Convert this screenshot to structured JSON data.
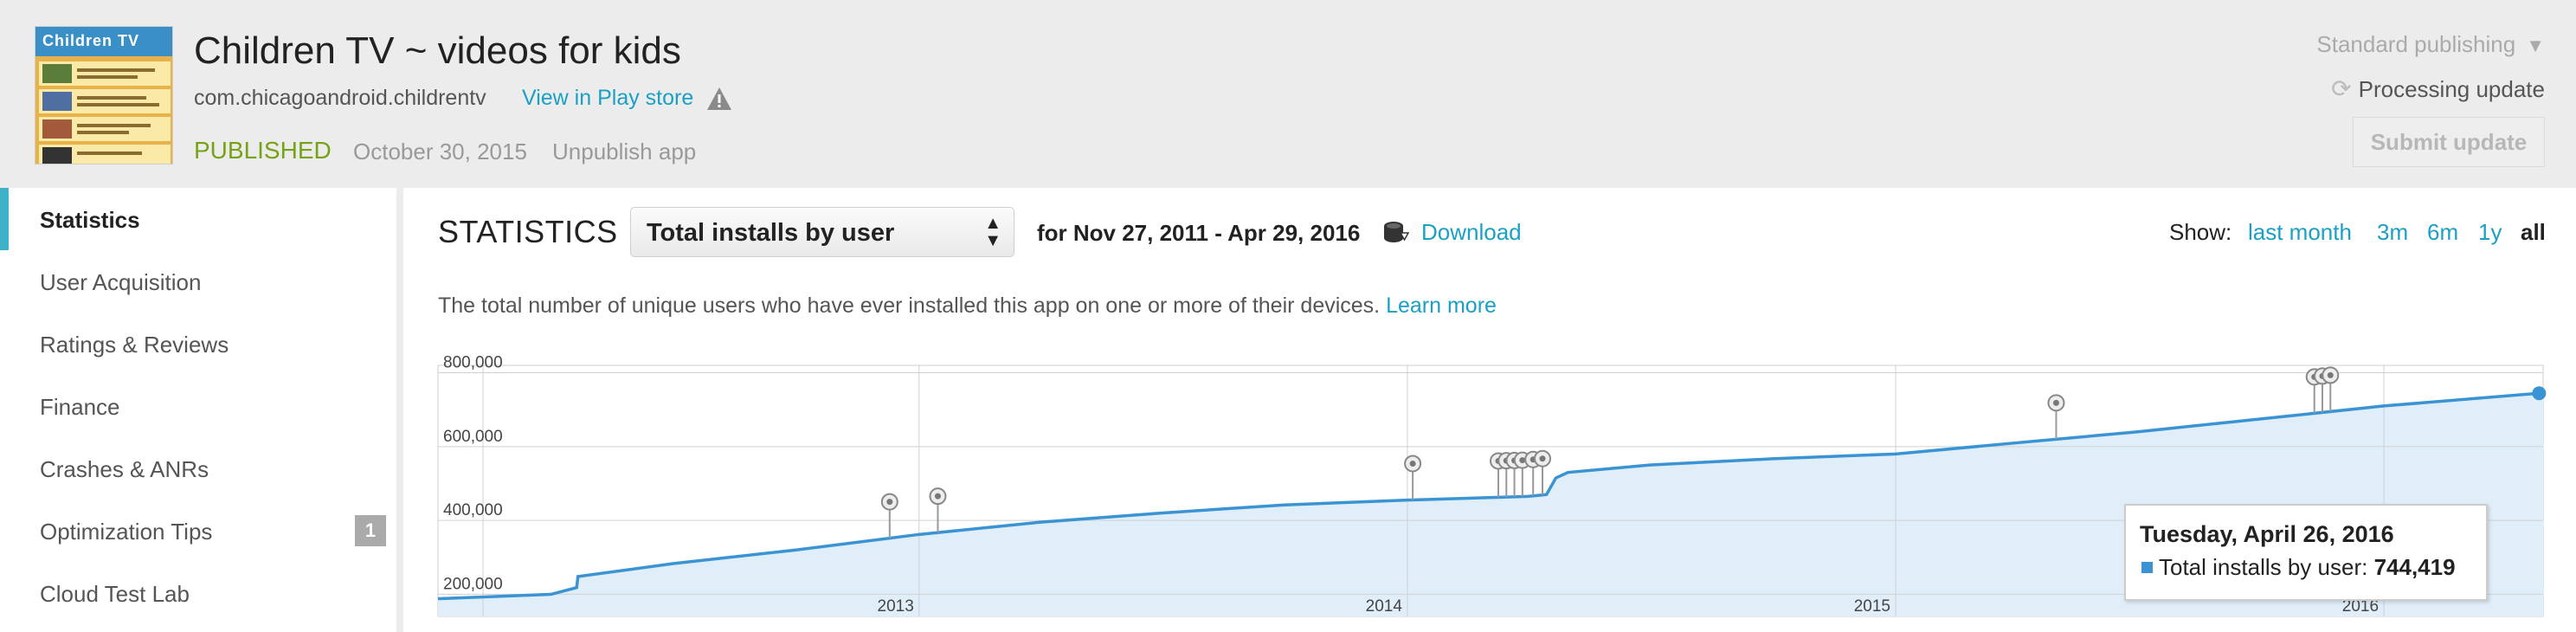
{
  "header": {
    "app_title": "Children TV ~ videos for kids",
    "package_name": "com.chicagoandroid.childrentv",
    "store_link": "View in Play store",
    "status": "PUBLISHED",
    "status_date": "October 30, 2015",
    "unpublish": "Unpublish app",
    "publishing_mode": "Standard publishing",
    "processing": "Processing update",
    "submit": "Submit update",
    "icon_banner": "Children TV",
    "accent_color": "#1aa0c4",
    "status_color": "#76a315"
  },
  "sidebar": {
    "items": [
      {
        "label": "Statistics",
        "active": true
      },
      {
        "label": "User Acquisition"
      },
      {
        "label": "Ratings & Reviews"
      },
      {
        "label": "Finance"
      },
      {
        "label": "Crashes & ANRs"
      },
      {
        "label": "Optimization Tips",
        "badge": "1"
      },
      {
        "label": "Cloud Test Lab"
      }
    ]
  },
  "main": {
    "title": "STATISTICS",
    "metric": "Total installs by user",
    "range": "for Nov 27, 2011 - Apr 29, 2016",
    "download": "Download",
    "show_label": "Show:",
    "show_options": [
      {
        "label": "last month"
      },
      {
        "label": "3m"
      },
      {
        "label": "6m"
      },
      {
        "label": "1y"
      },
      {
        "label": "all",
        "active": true
      }
    ],
    "description": "The total number of unique users who have ever installed this app on one or more of their devices.",
    "learn_more": "Learn more"
  },
  "tooltip": {
    "date": "Tuesday, April 26, 2016",
    "series": "Total installs by user:",
    "value": "744,419"
  },
  "chart_data": {
    "type": "area",
    "title": "",
    "xlabel": "",
    "ylabel": "",
    "y_ticks": [
      "800,000",
      "600,000",
      "400,000",
      "200,000"
    ],
    "x_ticks": [
      "2013",
      "2014",
      "2015",
      "2016"
    ],
    "series": [
      {
        "name": "Total installs by user",
        "color": "#3a93d3",
        "x": [
          "2012-04-01",
          "2012-04-20",
          "2012-04-21",
          "2012-07-01",
          "2012-10-01",
          "2013-01-01",
          "2013-04-01",
          "2013-07-01",
          "2013-10-01",
          "2014-01-01",
          "2014-04-01",
          "2014-04-15",
          "2014-04-22",
          "2014-05-01",
          "2014-07-01",
          "2014-10-01",
          "2015-01-01",
          "2015-04-01",
          "2015-07-01",
          "2015-10-01",
          "2016-01-01",
          "2016-04-26"
        ],
        "values": [
          200000,
          218000,
          248000,
          283000,
          320000,
          362000,
          395000,
          420000,
          442000,
          455000,
          465000,
          470000,
          515000,
          530000,
          550000,
          567000,
          580000,
          610000,
          640000,
          675000,
          710000,
          744419
        ]
      }
    ],
    "annotation_markers": [
      "2012-12-10",
      "2013-01-15",
      "2014-01-05",
      "2014-03-10",
      "2014-03-16",
      "2014-03-22",
      "2014-03-28",
      "2014-04-05",
      "2014-04-12",
      "2015-05-01",
      "2015-11-10",
      "2015-11-16",
      "2015-11-22"
    ],
    "xlim": [
      "2012-02-10",
      "2016-04-29"
    ],
    "ylim": [
      140000,
      820000
    ],
    "grid": true,
    "fill_color": "#dfeef9"
  }
}
